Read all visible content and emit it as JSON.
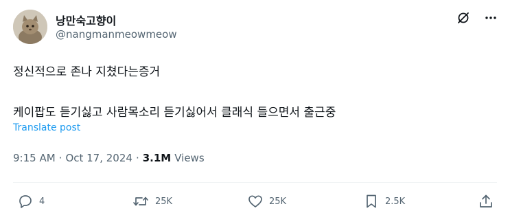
{
  "author": {
    "display_name": "낭만숙고향이",
    "handle": "@nangmanmeowmeow",
    "avatar_icon": "cat-avatar"
  },
  "header_icons": [
    "grok-icon",
    "more-icon"
  ],
  "post": {
    "line1": "정신적으로 존나 지쳤다는증거",
    "line2": "케이팝도 듣기싫고 사람목소리 듣기싫어서 클래식 들으면서 출근중",
    "translate_label": "Translate post"
  },
  "meta": {
    "time": "9:15 AM",
    "dot1": "·",
    "date": "Oct 17, 2024",
    "dot2": "·",
    "views_count": "3.1M",
    "views_label": "Views"
  },
  "actions": {
    "replies": "4",
    "reposts": "25K",
    "likes": "25K",
    "bookmarks": "2.5K"
  },
  "colors": {
    "text": "#0f1419",
    "secondary": "#536471",
    "link": "#1d9bf0",
    "divider": "#eff3f4"
  }
}
